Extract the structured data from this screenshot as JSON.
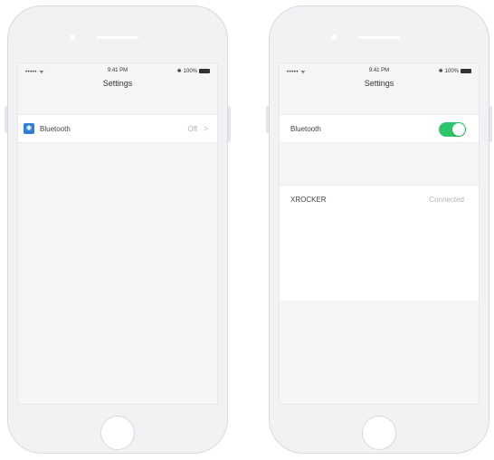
{
  "left_phone": {
    "status": {
      "signal": "••••• ᯤ",
      "time": "9:41 PM",
      "battery": "100%"
    },
    "title": "Settings",
    "bluetooth_row": {
      "label": "Bluetooth",
      "value": "Off",
      "chevron": ">"
    }
  },
  "right_phone": {
    "status": {
      "signal": "••••• ᯤ",
      "time": "9:41 PM",
      "battery": "100%"
    },
    "title": "Settings",
    "bluetooth_row": {
      "label": "Bluetooth",
      "toggle_on": true
    },
    "device_row": {
      "label": "XROCKER",
      "status": "Connected"
    }
  },
  "colors": {
    "toggle_on": "#2fc56b",
    "bluetooth_icon": "#2f7fd6"
  },
  "icons": [
    "bluetooth-icon",
    "wifi-icon",
    "battery-icon",
    "chevron-right-icon"
  ]
}
